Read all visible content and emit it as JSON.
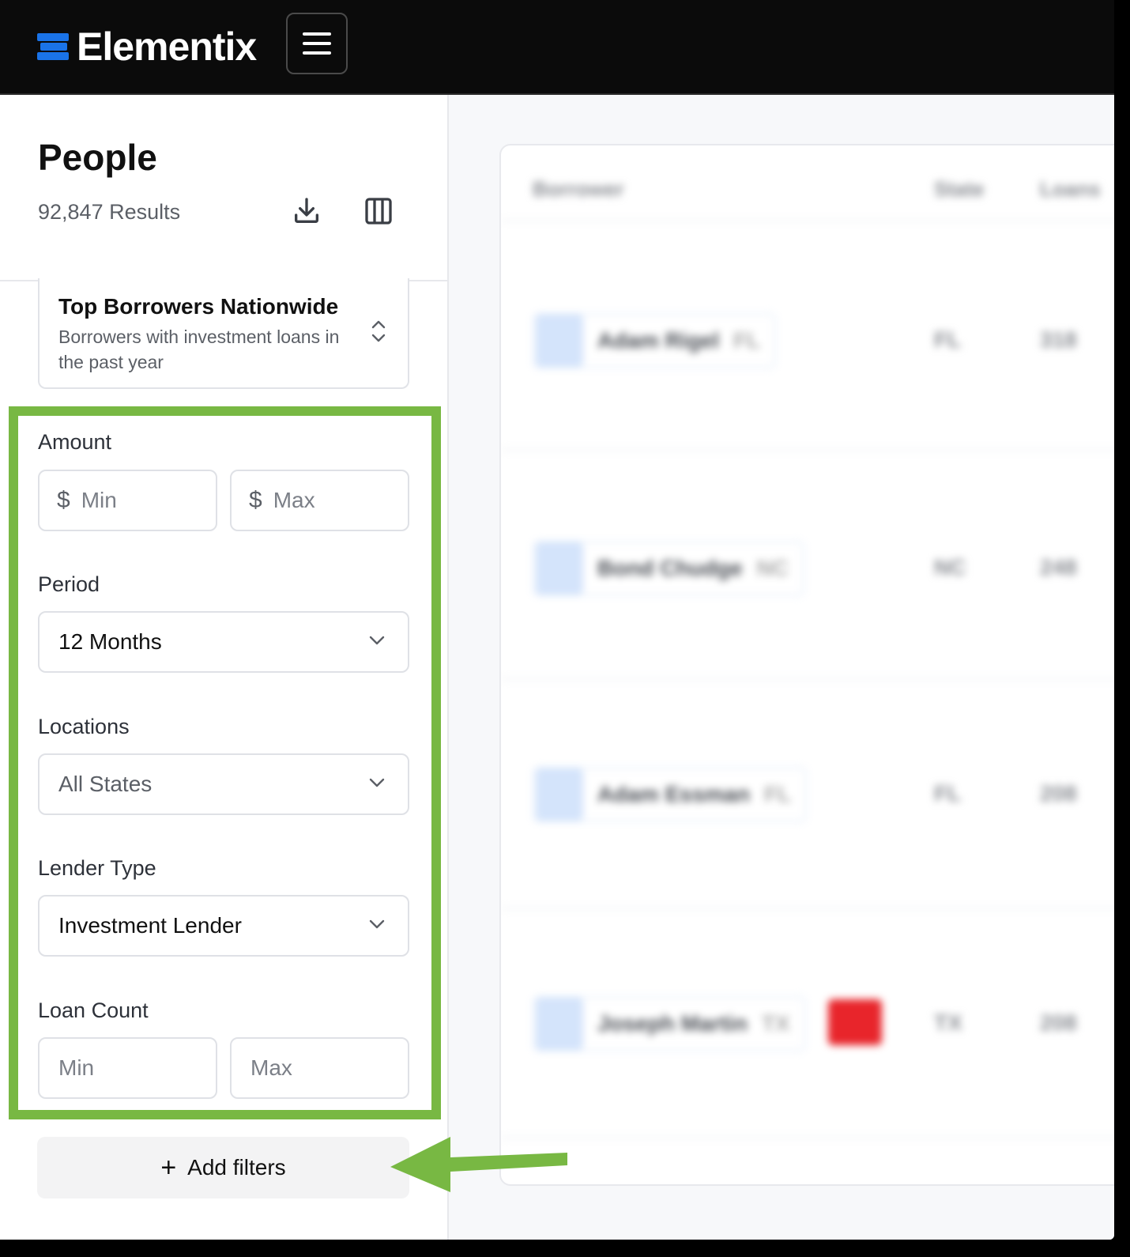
{
  "app": {
    "name": "Elementix",
    "brand_color": "#1a73e8",
    "highlight_color": "#78b843"
  },
  "header": {
    "menu_icon": "hamburger-icon"
  },
  "sidebar": {
    "title": "People",
    "results": "92,847 Results",
    "download_icon": "download-icon",
    "columns_icon": "columns-icon",
    "preset": {
      "title": "Top Borrowers Nationwide",
      "description": "Borrowers with investment loans in the past year"
    },
    "filters": {
      "amount": {
        "label": "Amount",
        "min_placeholder": "Min",
        "max_placeholder": "Max",
        "currency": "$"
      },
      "period": {
        "label": "Period",
        "value": "12 Months"
      },
      "locations": {
        "label": "Locations",
        "value": "All States"
      },
      "lender_type": {
        "label": "Lender Type",
        "value": "Investment Lender"
      },
      "loan_count": {
        "label": "Loan Count",
        "min_placeholder": "Min",
        "max_placeholder": "Max"
      }
    },
    "add_filters": {
      "label": "Add filters",
      "icon": "plus-icon"
    }
  },
  "table": {
    "columns": [
      "Borrower",
      "State",
      "Loans"
    ],
    "rows": [
      {
        "name": "Adam Rigel",
        "state_suffix": "FL",
        "state": "FL",
        "loans": "318"
      },
      {
        "name": "Bond Chudge",
        "state_suffix": "NC",
        "state": "NC",
        "loans": "248"
      },
      {
        "name": "Adam Essman",
        "state_suffix": "FL",
        "state": "FL",
        "loans": "208"
      },
      {
        "name": "Joseph Martin",
        "state_suffix": "TX",
        "state": "TX",
        "loans": "208"
      }
    ]
  }
}
